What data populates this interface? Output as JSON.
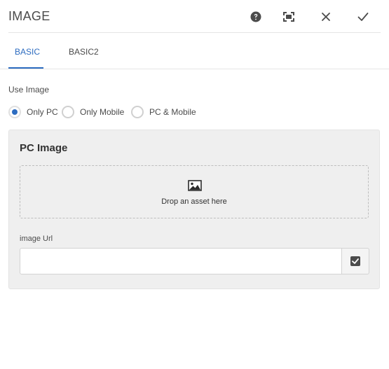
{
  "dialog": {
    "title": "IMAGE",
    "actions": [
      {
        "name": "help-icon"
      },
      {
        "name": "fullscreen-icon"
      },
      {
        "name": "close-icon"
      },
      {
        "name": "done-check-icon"
      }
    ]
  },
  "tabs": [
    {
      "label": "BASIC",
      "active": true
    },
    {
      "label": "BASIC2",
      "active": false
    }
  ],
  "use_image": {
    "label": "Use Image",
    "options": [
      {
        "label": "Only PC",
        "checked": true
      },
      {
        "label": "Only Mobile",
        "checked": false
      },
      {
        "label": "PC & Mobile",
        "checked": false
      }
    ]
  },
  "pc_image": {
    "title": "PC Image",
    "dropzone_text": "Drop an asset here",
    "dropzone_icon": "image-icon",
    "url_label": "image Url",
    "url_value": "",
    "url_button_icon": "checkbox-checked-icon"
  },
  "colors": {
    "accent": "#2d6cc0",
    "panel_bg": "#efefef",
    "text": "#323232"
  }
}
